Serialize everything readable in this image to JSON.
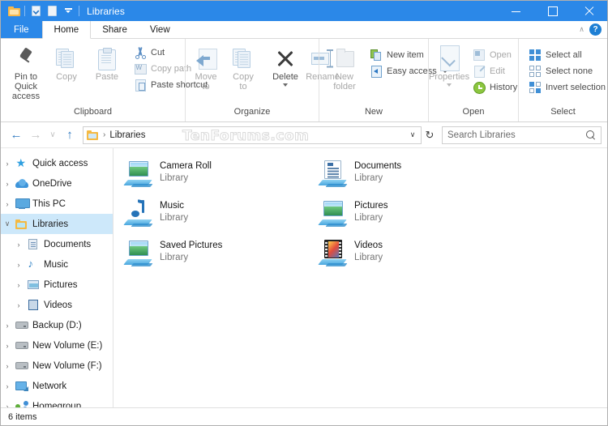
{
  "window": {
    "title": "Libraries",
    "quick_access_icons": [
      "folder-icon",
      "properties-check-icon",
      "new-folder-icon",
      "customize-dropdown-icon"
    ],
    "controls": {
      "minimize": "–",
      "maximize": "□",
      "close": "✕"
    }
  },
  "ribbon": {
    "tabs": [
      {
        "label": "File",
        "type": "file"
      },
      {
        "label": "Home",
        "type": "active"
      },
      {
        "label": "Share",
        "type": "normal"
      },
      {
        "label": "View",
        "type": "normal"
      }
    ],
    "help_label": "?",
    "collapse_label": "∧",
    "groups": [
      {
        "label": "Clipboard",
        "big_buttons": [
          {
            "label": "Pin to Quick access",
            "icon": "pin-icon",
            "disabled": false,
            "caret": false
          },
          {
            "label": "Copy",
            "icon": "copy-icon",
            "disabled": true,
            "caret": false
          },
          {
            "label": "Paste",
            "icon": "paste-icon",
            "disabled": true,
            "caret": false
          }
        ],
        "small_buttons": [
          {
            "label": "Cut",
            "icon": "scissors-icon",
            "disabled": true,
            "caret": false
          },
          {
            "label": "Copy path",
            "icon": "copy-path-icon",
            "disabled": true,
            "caret": false
          },
          {
            "label": "Paste shortcut",
            "icon": "paste-shortcut-icon",
            "disabled": true,
            "caret": false
          }
        ]
      },
      {
        "label": "Organize",
        "big_buttons": [
          {
            "label": "Move to",
            "icon": "move-to-icon",
            "disabled": true,
            "caret": false
          },
          {
            "label": "Copy to",
            "icon": "copy-to-icon",
            "disabled": true,
            "caret": true
          },
          {
            "label": "Delete",
            "icon": "delete-icon",
            "disabled": false,
            "caret": true
          },
          {
            "label": "Rename",
            "icon": "rename-icon",
            "disabled": true,
            "caret": false
          }
        ],
        "small_buttons": []
      },
      {
        "label": "New",
        "big_buttons": [
          {
            "label": "New folder",
            "icon": "new-folder-icon",
            "disabled": true,
            "caret": false
          }
        ],
        "small_buttons": [
          {
            "label": "New item",
            "icon": "new-item-icon",
            "disabled": false,
            "caret": false
          },
          {
            "label": "Easy access",
            "icon": "easy-access-icon",
            "disabled": false,
            "caret": true
          }
        ]
      },
      {
        "label": "Open",
        "big_buttons": [
          {
            "label": "Properties",
            "icon": "properties-icon",
            "disabled": true,
            "caret": true
          }
        ],
        "small_buttons": [
          {
            "label": "Open",
            "icon": "open-icon",
            "disabled": true,
            "caret": false
          },
          {
            "label": "Edit",
            "icon": "edit-icon",
            "disabled": true,
            "caret": false
          },
          {
            "label": "History",
            "icon": "history-icon",
            "disabled": false,
            "caret": false
          }
        ]
      },
      {
        "label": "Select",
        "big_buttons": [],
        "small_buttons": [
          {
            "label": "Select all",
            "icon": "select-all-icon",
            "disabled": false,
            "caret": false
          },
          {
            "label": "Select none",
            "icon": "select-none-icon",
            "disabled": false,
            "caret": false
          },
          {
            "label": "Invert selection",
            "icon": "invert-selection-icon",
            "disabled": false,
            "caret": false
          }
        ]
      }
    ]
  },
  "addressbar": {
    "back_label": "←",
    "forward_label": "→",
    "recent_label": "∨",
    "up_label": "↑",
    "breadcrumb_icon": "libraries-folder-icon",
    "breadcrumb_separator": "›",
    "breadcrumb": "Libraries",
    "watermark": "TenForums.com",
    "dropdown_label": "∨",
    "refresh_label": "↻"
  },
  "search": {
    "placeholder": "Search Libraries",
    "icon": "search-icon"
  },
  "sidebar": {
    "items": [
      {
        "label": "Quick access",
        "icon": "star-icon",
        "level": 0,
        "expanded": false,
        "selected": false
      },
      {
        "label": "OneDrive",
        "icon": "cloud-icon",
        "level": 0,
        "expanded": false,
        "selected": false
      },
      {
        "label": "This PC",
        "icon": "monitor-icon",
        "level": 0,
        "expanded": false,
        "selected": false
      },
      {
        "label": "Libraries",
        "icon": "library-icon",
        "level": 0,
        "expanded": true,
        "selected": true
      },
      {
        "label": "Documents",
        "icon": "document-icon",
        "level": 1,
        "expanded": false,
        "selected": false
      },
      {
        "label": "Music",
        "icon": "music-icon",
        "level": 1,
        "expanded": false,
        "selected": false
      },
      {
        "label": "Pictures",
        "icon": "picture-icon",
        "level": 1,
        "expanded": false,
        "selected": false
      },
      {
        "label": "Videos",
        "icon": "video-icon",
        "level": 1,
        "expanded": false,
        "selected": false
      },
      {
        "label": "Backup (D:)",
        "icon": "drive-icon",
        "level": 0,
        "expanded": false,
        "selected": false
      },
      {
        "label": "New Volume (E:)",
        "icon": "drive-icon",
        "level": 0,
        "expanded": false,
        "selected": false
      },
      {
        "label": "New Volume (F:)",
        "icon": "drive-icon",
        "level": 0,
        "expanded": false,
        "selected": false
      },
      {
        "label": "Network",
        "icon": "network-icon",
        "level": 0,
        "expanded": false,
        "selected": false
      },
      {
        "label": "Homegroup",
        "icon": "homegroup-icon",
        "level": 0,
        "expanded": false,
        "selected": false
      }
    ],
    "chevron_collapsed": "›",
    "chevron_expanded": "∨"
  },
  "content": {
    "items": [
      {
        "name": "Camera Roll",
        "subtitle": "Library",
        "icon": "picture-library-icon"
      },
      {
        "name": "Documents",
        "subtitle": "Library",
        "icon": "document-library-icon"
      },
      {
        "name": "Music",
        "subtitle": "Library",
        "icon": "music-library-icon"
      },
      {
        "name": "Pictures",
        "subtitle": "Library",
        "icon": "picture-library-icon"
      },
      {
        "name": "Saved Pictures",
        "subtitle": "Library",
        "icon": "picture-library-icon"
      },
      {
        "name": "Videos",
        "subtitle": "Library",
        "icon": "video-library-icon"
      }
    ]
  },
  "statusbar": {
    "item_count": "6 items"
  },
  "colors": {
    "titlebar": "#2b88e8",
    "accent": "#2b88e8",
    "selection": "#cde8fa",
    "folder_yellow": "#f5b942",
    "text": "#1c1c1c",
    "disabled_text": "#a8a8a8"
  }
}
